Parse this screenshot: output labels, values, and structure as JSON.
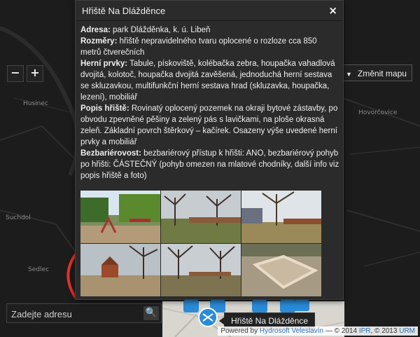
{
  "map": {
    "places": [
      "Husinec",
      "Suchdol",
      "Sedlec",
      "Hovorčovice"
    ],
    "zoom_in_label": "+",
    "zoom_out_label": "−",
    "change_map_label": "Změnit mapu",
    "change_map_icon": "chevron-down-icon"
  },
  "search": {
    "placeholder": "Zadejte adresu",
    "button_icon": "search-icon",
    "button_glyph": "🔍"
  },
  "tooltip": {
    "text": "Hřiště Na Dlážděnce"
  },
  "attribution": {
    "prefix": "Powered by ",
    "hydrosoft": "Hydrosoft Veleslavín",
    "mid1": " — © 2014 ",
    "ipr": "IPR",
    "mid2": ", © 2013 ",
    "urm": "URM"
  },
  "popup": {
    "title": "Hřiště Na Dlážděnce",
    "close_label": "×",
    "fields": [
      {
        "label": "Adresa:",
        "value": "park Dlážděnka, k. ú. Libeň"
      },
      {
        "label": "Rozměry:",
        "value": "hřiště nepravidelného tvaru oplocené o rozloze cca 850 metrů čtverečních"
      },
      {
        "label": "Herní prvky:",
        "value": "Tabule, pískoviště, kolébačka zebra, houpačka vahadlová dvojitá, kolotoč, houpačka dvojitá zavěšená, jednoduchá herní sestava se skluzavkou, multifunkční herní sestava hrad (skluzavka, houpačka, lezení), mobiliář"
      },
      {
        "label": "Popis hřiště:",
        "value": "Rovinatý oplocený pozemek na okraji bytové zástavby, po obvodu zpevněné pěšiny a zelený pás s lavičkami, na ploše okrasná zeleň. Základní povrch štěrkový – kačírek. Osazeny výše uvedené herní prvky a mobiliář"
      },
      {
        "label": "Bezbariérovost:",
        "value": "bezbariérový přístup k hřišti: ANO, bezbariérový pohyb po hřišti: ČÁSTEČNÝ (pohyb omezen na mlatové chodníky, další info viz popis hřiště a foto)"
      }
    ],
    "photo_count": 6
  },
  "colors": {
    "map_bg": "#1b1b1b",
    "popup_bg": "#2b2b2b",
    "marker_blue": "#2a8bd8",
    "area_red": "#e8302a",
    "link_blue": "#2a6fb0"
  }
}
